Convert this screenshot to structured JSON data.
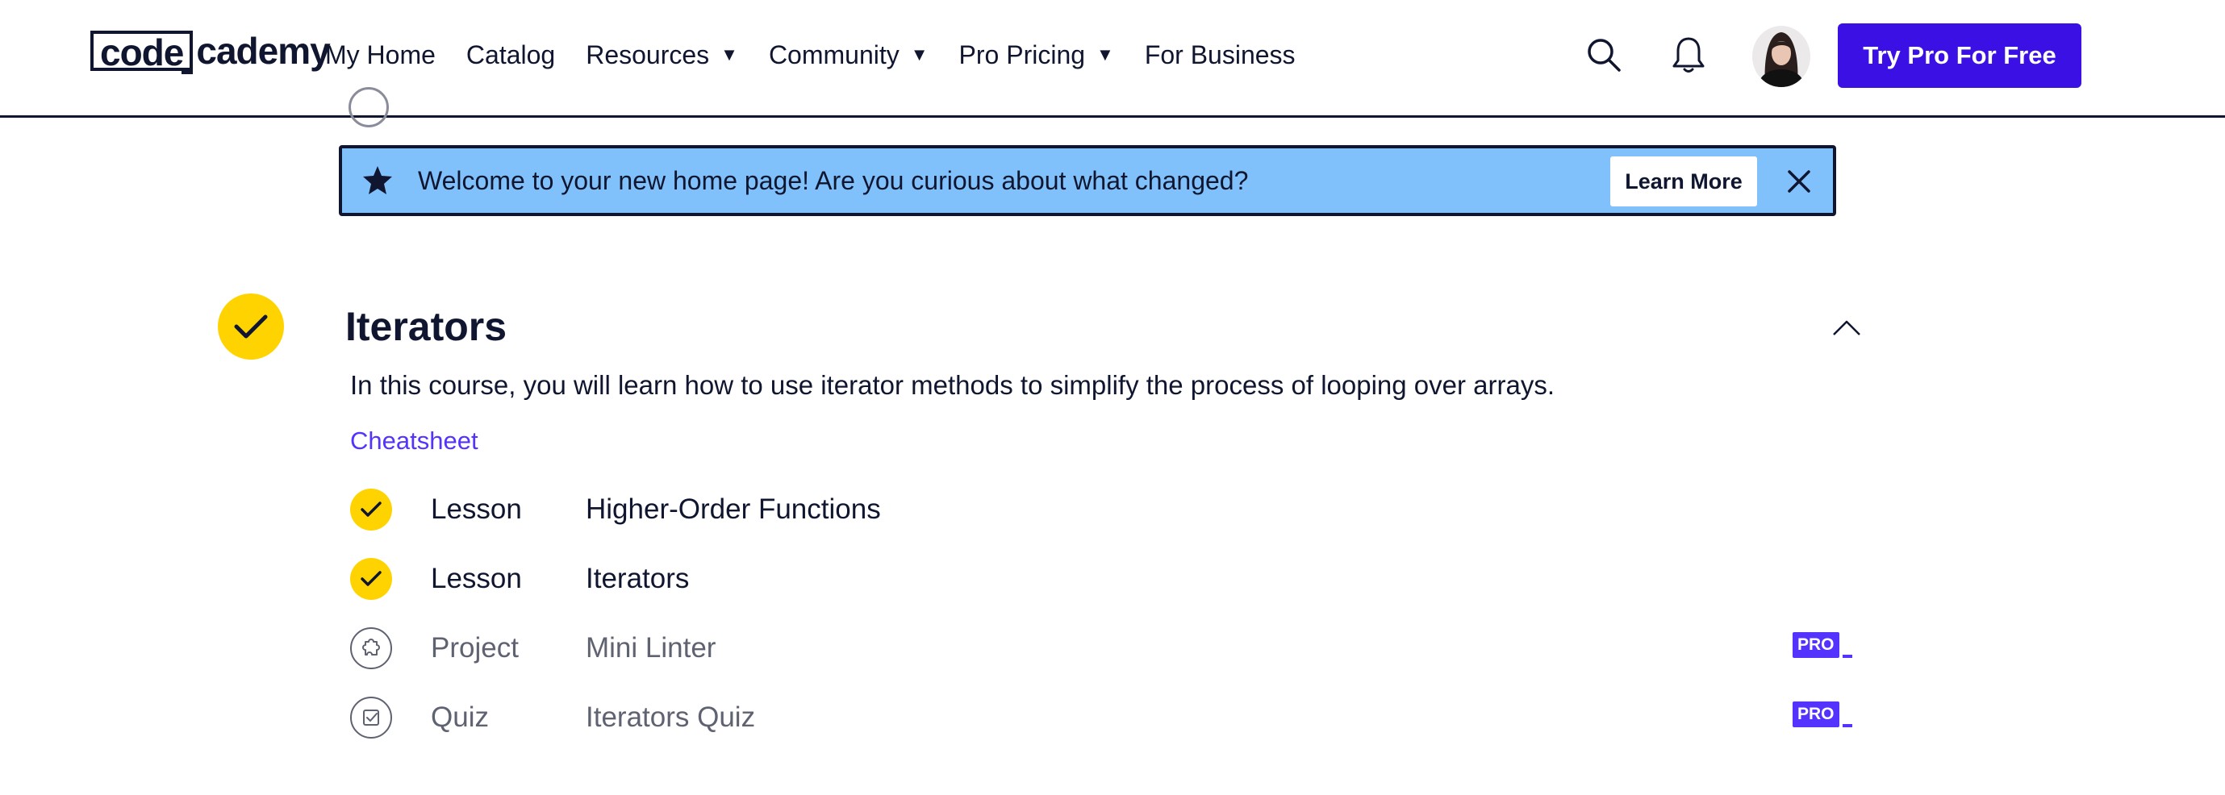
{
  "header": {
    "logo_part1": "code",
    "logo_part2": "cademy",
    "nav": [
      {
        "label": "My Home",
        "dropdown": false
      },
      {
        "label": "Catalog",
        "dropdown": false
      },
      {
        "label": "Resources",
        "dropdown": true
      },
      {
        "label": "Community",
        "dropdown": true
      },
      {
        "label": "Pro Pricing",
        "dropdown": true
      },
      {
        "label": "For Business",
        "dropdown": false
      }
    ],
    "icons": {
      "search": "search-icon",
      "notifications": "bell-icon",
      "avatar": "user-avatar"
    },
    "cta_label": "Try Pro For Free"
  },
  "banner": {
    "icon": "star-icon",
    "message": "Welcome to your new home page! Are you curious about what changed?",
    "learn_more_label": "Learn More",
    "close_icon": "close-icon"
  },
  "module": {
    "title": "Iterators",
    "completed": true,
    "description": "In this course, you will learn how to use iterator methods to simplify the process of looping over arrays.",
    "cheatsheet_label": "Cheatsheet",
    "items": [
      {
        "type": "Lesson",
        "title": "Higher-Order Functions",
        "status": "complete",
        "pro": false
      },
      {
        "type": "Lesson",
        "title": "Iterators",
        "status": "complete",
        "pro": false
      },
      {
        "type": "Project",
        "title": "Mini Linter",
        "status": "locked",
        "icon": "puzzle-icon",
        "pro": true
      },
      {
        "type": "Quiz",
        "title": "Iterators Quiz",
        "status": "locked",
        "icon": "quiz-icon",
        "pro": true
      }
    ],
    "pro_badge_label": "PRO"
  },
  "colors": {
    "brand_dark": "#10162f",
    "cta_blue": "#3a10e5",
    "banner_blue": "#80c1fb",
    "check_yellow": "#ffd300",
    "link_purple": "#5533ff"
  }
}
